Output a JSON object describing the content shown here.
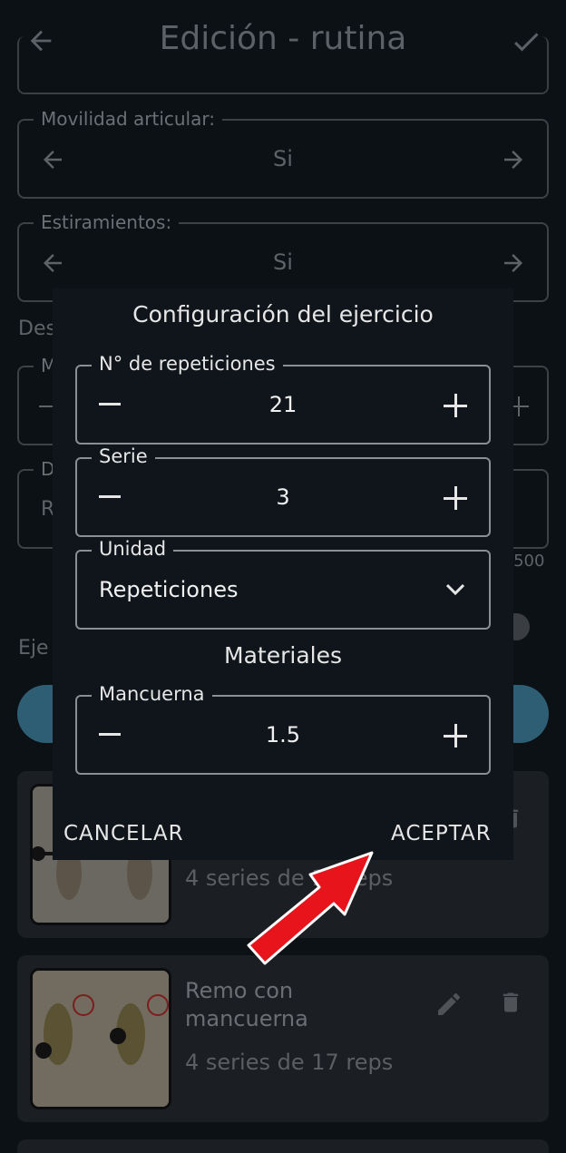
{
  "app_bar": {
    "title": "Edición - rutina",
    "back_icon": "arrow-left-icon",
    "confirm_icon": "check-icon"
  },
  "background": {
    "movilidad": {
      "label": "Movilidad articular:",
      "value": "Si"
    },
    "estiramientos": {
      "label": "Estiramientos:",
      "value": "Si"
    },
    "partial_section_label": "Des",
    "partial_field_a_label": "M",
    "partial_field_b_label": "D",
    "partial_field_b_value": "R",
    "char_counter": "/500",
    "partial_exercises_label": "Eje",
    "exercises": [
      {
        "name": "",
        "subtitle": "4 series de 16 reps"
      },
      {
        "name": "Remo con mancuerna",
        "subtitle": "4 series de 17 reps"
      }
    ]
  },
  "dialog": {
    "title": "Configuración del ejercicio",
    "repeticiones": {
      "label": "N° de repeticiones",
      "value": "21"
    },
    "serie": {
      "label": "Serie",
      "value": "3"
    },
    "unidad": {
      "label": "Unidad",
      "selected": "Repeticiones"
    },
    "materials_title": "Materiales",
    "mancuerna": {
      "label": "Mancuerna",
      "value": "1.5"
    },
    "cancel_label": "CANCELAR",
    "accept_label": "ACEPTAR"
  },
  "colors": {
    "dialog_bg": "#0f151b",
    "accent_button": "#2d5e74",
    "annotation_arrow": "#e8141c"
  }
}
